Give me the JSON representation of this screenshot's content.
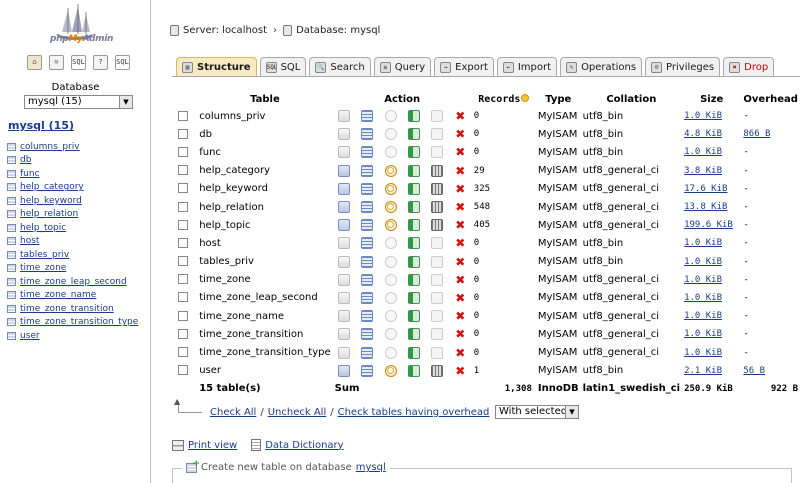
{
  "sidebar": {
    "logo_text_pre": "php",
    "logo_text_mid": "My",
    "logo_text_post": "Admin",
    "nav_icons": [
      {
        "name": "home-icon",
        "glyph": "⌂"
      },
      {
        "name": "exit-icon",
        "glyph": "⎋"
      },
      {
        "name": "sql-query-icon",
        "glyph": "SQL"
      },
      {
        "name": "help-icon",
        "glyph": "?"
      },
      {
        "name": "sql-docs-icon",
        "glyph": "SQL"
      }
    ],
    "database_label": "Database",
    "database_select": "mysql (15)",
    "db_heading": "mysql (15)",
    "tables": [
      "columns_priv",
      "db",
      "func",
      "help_category",
      "help_keyword",
      "help_relation",
      "help_topic",
      "host",
      "tables_priv",
      "time_zone",
      "time_zone_leap_second",
      "time_zone_name",
      "time_zone_transition",
      "time_zone_transition_type",
      "user"
    ]
  },
  "breadcrumb": {
    "server": "Server: localhost",
    "database": "Database: mysql"
  },
  "tabs": [
    {
      "label": "Structure",
      "icon": "structure-icon",
      "glyph": "▤"
    },
    {
      "label": "SQL",
      "icon": "sql-icon",
      "glyph": "SQL"
    },
    {
      "label": "Search",
      "icon": "search-icon",
      "glyph": "🔍"
    },
    {
      "label": "Query",
      "icon": "query-icon",
      "glyph": "≡"
    },
    {
      "label": "Export",
      "icon": "export-icon",
      "glyph": "→"
    },
    {
      "label": "Import",
      "icon": "import-icon",
      "glyph": "←"
    },
    {
      "label": "Operations",
      "icon": "operations-icon",
      "glyph": "✎"
    },
    {
      "label": "Privileges",
      "icon": "privileges-icon",
      "glyph": "☺"
    },
    {
      "label": "Drop",
      "icon": "drop-icon",
      "glyph": "✖"
    }
  ],
  "table_headers": {
    "table": "Table",
    "action": "Action",
    "records": "Records",
    "type": "Type",
    "collation": "Collation",
    "size": "Size",
    "overhead": "Overhead"
  },
  "rows": [
    {
      "name": "columns_priv",
      "records": "0",
      "type": "MyISAM",
      "collation": "utf8_bin",
      "size": "1.0 KiB",
      "overhead": "-",
      "has_data": false
    },
    {
      "name": "db",
      "records": "0",
      "type": "MyISAM",
      "collation": "utf8_bin",
      "size": "4.8 KiB",
      "overhead": "866 B",
      "has_data": false
    },
    {
      "name": "func",
      "records": "0",
      "type": "MyISAM",
      "collation": "utf8_bin",
      "size": "1.0 KiB",
      "overhead": "-",
      "has_data": false
    },
    {
      "name": "help_category",
      "records": "29",
      "type": "MyISAM",
      "collation": "utf8_general_ci",
      "size": "3.8 KiB",
      "overhead": "-",
      "has_data": true
    },
    {
      "name": "help_keyword",
      "records": "325",
      "type": "MyISAM",
      "collation": "utf8_general_ci",
      "size": "17.6 KiB",
      "overhead": "-",
      "has_data": true
    },
    {
      "name": "help_relation",
      "records": "548",
      "type": "MyISAM",
      "collation": "utf8_general_ci",
      "size": "13.8 KiB",
      "overhead": "-",
      "has_data": true
    },
    {
      "name": "help_topic",
      "records": "405",
      "type": "MyISAM",
      "collation": "utf8_general_ci",
      "size": "199.6 KiB",
      "overhead": "-",
      "has_data": true
    },
    {
      "name": "host",
      "records": "0",
      "type": "MyISAM",
      "collation": "utf8_bin",
      "size": "1.0 KiB",
      "overhead": "-",
      "has_data": false
    },
    {
      "name": "tables_priv",
      "records": "0",
      "type": "MyISAM",
      "collation": "utf8_bin",
      "size": "1.0 KiB",
      "overhead": "-",
      "has_data": false
    },
    {
      "name": "time_zone",
      "records": "0",
      "type": "MyISAM",
      "collation": "utf8_general_ci",
      "size": "1.0 KiB",
      "overhead": "-",
      "has_data": false
    },
    {
      "name": "time_zone_leap_second",
      "records": "0",
      "type": "MyISAM",
      "collation": "utf8_general_ci",
      "size": "1.0 KiB",
      "overhead": "-",
      "has_data": false
    },
    {
      "name": "time_zone_name",
      "records": "0",
      "type": "MyISAM",
      "collation": "utf8_general_ci",
      "size": "1.0 KiB",
      "overhead": "-",
      "has_data": false
    },
    {
      "name": "time_zone_transition",
      "records": "0",
      "type": "MyISAM",
      "collation": "utf8_general_ci",
      "size": "1.0 KiB",
      "overhead": "-",
      "has_data": false
    },
    {
      "name": "time_zone_transition_type",
      "records": "0",
      "type": "MyISAM",
      "collation": "utf8_general_ci",
      "size": "1.0 KiB",
      "overhead": "-",
      "has_data": false
    },
    {
      "name": "user",
      "records": "1",
      "type": "MyISAM",
      "collation": "utf8_bin",
      "size": "2.1 KiB",
      "overhead": "56 B",
      "has_data": true
    }
  ],
  "summary": {
    "count": "15 table(s)",
    "label": "Sum",
    "records": "1,308",
    "type": "InnoDB",
    "collation": "latin1_swedish_ci",
    "size": "250.9 KiB",
    "overhead": "922 B"
  },
  "bulk": {
    "check_all": "Check All",
    "sep": "/",
    "uncheck_all": "Uncheck All",
    "check_overhead": "Check tables having overhead",
    "with_selected": "With selected:"
  },
  "footer": {
    "print_view": "Print view",
    "data_dictionary": "Data Dictionary",
    "create_prefix": "Create new table on database",
    "create_db": "mysql"
  },
  "colors": {
    "link": "#1a3c8a",
    "active_tab": "#f8eac3",
    "drop": "#d21212"
  }
}
